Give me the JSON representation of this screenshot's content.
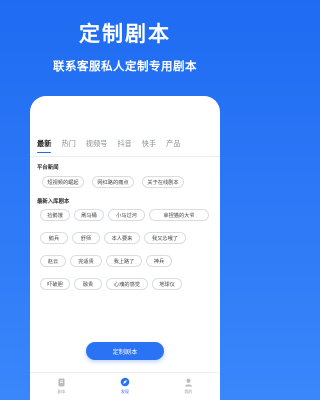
{
  "hero": {
    "title": "定制剧本",
    "subtitle": "联系客服私人定制专用剧本"
  },
  "tabs": [
    "最新",
    "热门",
    "视频号",
    "抖音",
    "快手",
    "产品"
  ],
  "sections": {
    "platform_news": {
      "title": "平台新闻",
      "items": [
        "短视频的崛起",
        "网红路的痛点",
        "关于在线剧本"
      ]
    },
    "latest_scripts": {
      "title": "最新入库剧本",
      "items": [
        "捡鹅饿",
        "刷马桶",
        "小马过河",
        "拿捏猫的大爷",
        "鹅兵",
        "舒师",
        "本人要来",
        "我又怂哦了",
        "赵云",
        "完适贵",
        "我上路了",
        "神兵",
        "吓破胆",
        "融贵",
        "心魂的感觉",
        "地球仪"
      ]
    }
  },
  "cta": {
    "label": "定制剧本"
  },
  "tabbar": {
    "items": [
      {
        "label": "剧本",
        "icon": "script-icon",
        "active": false
      },
      {
        "label": "发现",
        "icon": "discover-icon",
        "active": true
      },
      {
        "label": "我的",
        "icon": "profile-icon",
        "active": false
      }
    ]
  },
  "colors": {
    "brand": "#2a73f5",
    "background_top": "#1f6bf2",
    "text_muted": "#8a8f99"
  }
}
